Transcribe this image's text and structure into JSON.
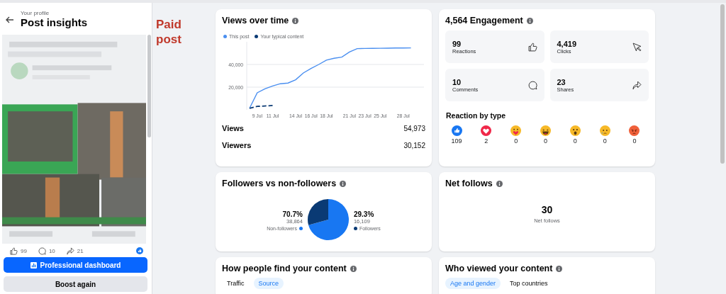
{
  "header": {
    "subtitle": "Your profile",
    "title": "Post insights"
  },
  "post_preview": {
    "kind": "picture",
    "reactions": [
      {
        "kind": "like",
        "count": "99"
      },
      {
        "kind": "comment",
        "count": "10"
      },
      {
        "kind": "share",
        "count": "21"
      }
    ]
  },
  "buttons": [
    {
      "label": "Professional dashboard",
      "kind": "primary"
    },
    {
      "label": "Boost again",
      "kind": "secondary"
    }
  ],
  "badge": "Paid post",
  "views_card": {
    "title": "Views over time",
    "chart_data": {
      "type": "line",
      "categories": [
        null,
        "9 Jul",
        null,
        "11 Jul",
        null,
        null,
        "14 Jul",
        null,
        "16 Jul",
        null,
        "18 Jul",
        null,
        null,
        "21 Jul",
        null,
        "23 Jul",
        null,
        "25 Jul",
        null,
        null,
        "28 Jul",
        null
      ],
      "series": [
        {
          "name": "This post",
          "color": "#4a8ff0",
          "line_style": "solid",
          "values": [
            1400,
            15000,
            18500,
            21000,
            23000,
            23600,
            26500,
            32500,
            36500,
            40000,
            43800,
            45500,
            46500,
            51000,
            54000,
            54100,
            54200,
            54300,
            54400,
            54500,
            54500,
            54600
          ]
        },
        {
          "name": "Your typical content",
          "color": "#0a3a74",
          "line_style": "dashed",
          "values": [
            1400,
            3000,
            3400,
            3800,
            null,
            null,
            null,
            null,
            null,
            null,
            null,
            null,
            null,
            null,
            null,
            null,
            null,
            null,
            null,
            null,
            null,
            null
          ]
        }
      ],
      "ylim": [
        0,
        60000
      ],
      "yticks": [
        {
          "value": 20000,
          "label": "20,000"
        },
        {
          "value": 40000,
          "label": "40,000"
        }
      ]
    },
    "stats": [
      {
        "label": "Views",
        "value": "54,973"
      },
      {
        "label": "Viewers",
        "value": "30,152"
      }
    ]
  },
  "engagement_card": {
    "title": "4,564 Engagement",
    "tiles": [
      {
        "kind": "reactions",
        "value": "99",
        "label": "Reactions"
      },
      {
        "kind": "clicks",
        "value": "4,419",
        "label": "Clicks"
      },
      {
        "kind": "comments",
        "value": "10",
        "label": "Comments"
      },
      {
        "kind": "shares",
        "value": "23",
        "label": "Shares"
      }
    ],
    "reaction_heading": "Reaction by type",
    "reactions": [
      {
        "kind": "like",
        "count": "109"
      },
      {
        "kind": "love",
        "count": "2"
      },
      {
        "kind": "care",
        "count": "0"
      },
      {
        "kind": "haha",
        "count": "0"
      },
      {
        "kind": "wow",
        "count": "0"
      },
      {
        "kind": "sad",
        "count": "0"
      },
      {
        "kind": "angry",
        "count": "0"
      }
    ]
  },
  "followers_card": {
    "title": "Followers vs non-followers",
    "segments": [
      {
        "percent": "70.7%",
        "count": "38,864",
        "color": "#1877f2"
      },
      {
        "percent": "29.3%",
        "count": "16,109",
        "color": "#0a3a74"
      }
    ],
    "chart_data": {
      "type": "pie",
      "categories": [
        "Non-followers",
        "Followers"
      ],
      "values": [
        70.7,
        29.3
      ]
    }
  },
  "net_follows_card": {
    "title": "Net follows",
    "value": "30",
    "label": "Net follows"
  },
  "source_card": {
    "title": "How people find your content",
    "tabs": [
      {
        "label": "Traffic",
        "selected": false
      },
      {
        "label": "Source",
        "selected": true
      }
    ]
  },
  "audience_card": {
    "title": "Who viewed your content",
    "tabs": [
      {
        "label": "Age and gender",
        "selected": true
      },
      {
        "label": "Top countries",
        "selected": false
      }
    ]
  }
}
